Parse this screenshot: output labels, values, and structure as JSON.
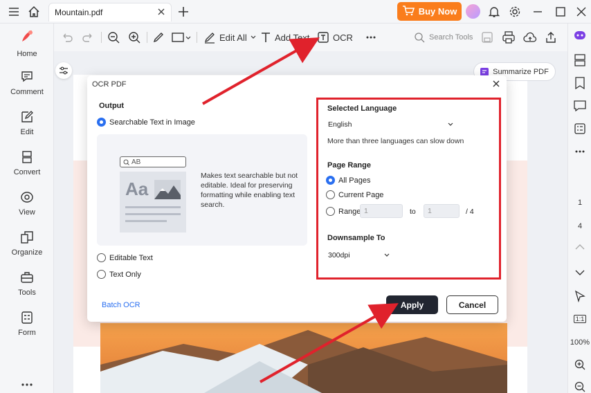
{
  "tab": {
    "title": "Mountain.pdf"
  },
  "topbar": {
    "buy_label": "Buy Now"
  },
  "sidebar": {
    "items": [
      {
        "label": "Home",
        "icon": "home-logo-icon"
      },
      {
        "label": "Comment",
        "icon": "comment-icon"
      },
      {
        "label": "Edit",
        "icon": "edit-icon"
      },
      {
        "label": "Convert",
        "icon": "convert-icon"
      },
      {
        "label": "View",
        "icon": "view-icon"
      },
      {
        "label": "Organize",
        "icon": "organize-icon"
      },
      {
        "label": "Tools",
        "icon": "tools-icon"
      },
      {
        "label": "Form",
        "icon": "form-icon"
      }
    ]
  },
  "toolbar": {
    "edit_all": "Edit All",
    "add_text": "Add Text",
    "ocr": "OCR",
    "search_tools": "Search Tools"
  },
  "rightbar": {
    "page_current": "1",
    "page_total": "4",
    "fit": "1:1",
    "zoom": "100%"
  },
  "summarize": {
    "label": "Summarize PDF"
  },
  "dialog": {
    "title": "OCR PDF",
    "output": {
      "title": "Output",
      "options": [
        "Searchable Text in Image",
        "Editable Text",
        "Text Only"
      ],
      "selected": 0,
      "preview_search": "AB",
      "preview_sample": "Aa",
      "description": "Makes text searchable but not editable. Ideal for preserving formatting while enabling text search."
    },
    "language": {
      "title": "Selected Language",
      "value": "English",
      "note": "More than three languages can slow down"
    },
    "page_range": {
      "title": "Page Range",
      "options": [
        "All Pages",
        "Current Page",
        "Range"
      ],
      "selected": 0,
      "from": "1",
      "to_label": "to",
      "to": "1",
      "total": "/ 4"
    },
    "downsample": {
      "title": "Downsample To",
      "value": "300dpi"
    },
    "batch_label": "Batch OCR",
    "apply_label": "Apply",
    "cancel_label": "Cancel"
  },
  "colors": {
    "accent": "#2a6ff0",
    "buy": "#fa7d1c",
    "highlight": "#e0222c",
    "apply_bg": "#222631"
  }
}
